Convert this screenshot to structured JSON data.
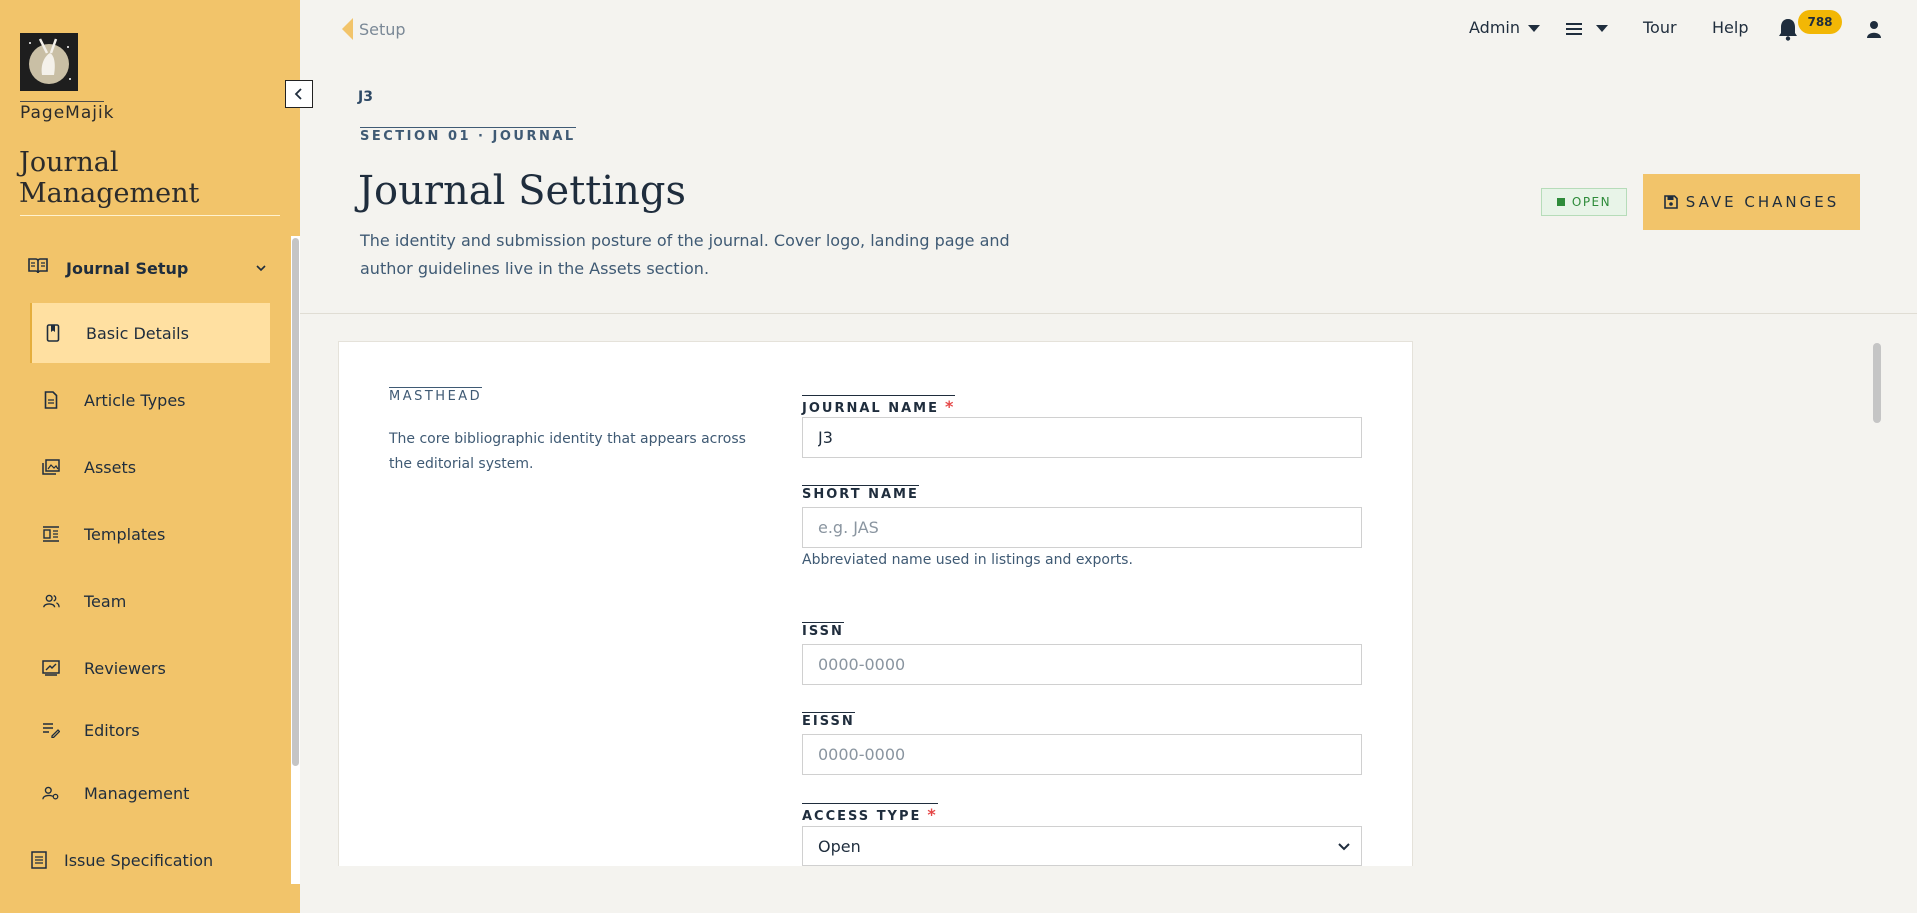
{
  "sidebar": {
    "brand_name": "PageMajik",
    "app_title": "Journal Management",
    "group": {
      "label": "Journal Setup"
    },
    "items": [
      {
        "label": "Basic Details",
        "icon": "bookmark-icon"
      },
      {
        "label": "Article Types",
        "icon": "document-icon"
      },
      {
        "label": "Assets",
        "icon": "assets-icon"
      },
      {
        "label": "Templates",
        "icon": "template-icon"
      },
      {
        "label": "Team",
        "icon": "team-icon"
      },
      {
        "label": "Reviewers",
        "icon": "reviewer-icon"
      },
      {
        "label": "Editors",
        "icon": "editor-icon"
      },
      {
        "label": "Management",
        "icon": "management-icon"
      },
      {
        "label": "Issue Specification",
        "icon": "list-icon"
      }
    ]
  },
  "topbar": {
    "back_label": "Setup",
    "admin_label": "Admin",
    "tour_label": "Tour",
    "help_label": "Help",
    "notification_count": "788"
  },
  "header": {
    "journal_code": "J3",
    "section_label": "SECTION 01 · JOURNAL",
    "title": "Journal Settings",
    "description": "The identity and submission posture of the journal. Cover logo, landing page and author guidelines live in the Assets section.",
    "status": "OPEN",
    "status_color": "#2e8b3a",
    "save_label": "SAVE CHANGES",
    "accent_color": "#f2c46a"
  },
  "masthead": {
    "label": "MASTHEAD",
    "description": "The core bibliographic identity that appears across the editorial system.",
    "fields": {
      "journal_name": {
        "label": "JOURNAL NAME",
        "required": "*",
        "value": "J3"
      },
      "short_name": {
        "label": "SHORT NAME",
        "placeholder": "e.g. JAS",
        "help": "Abbreviated name used in listings and exports."
      },
      "issn": {
        "label": "ISSN",
        "placeholder": "0000-0000"
      },
      "eissn": {
        "label": "EISSN",
        "placeholder": "0000-0000"
      },
      "access_type": {
        "label": "ACCESS TYPE",
        "required": "*",
        "value": "Open"
      }
    }
  }
}
